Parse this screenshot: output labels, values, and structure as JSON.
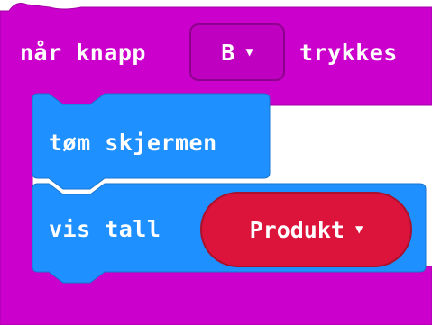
{
  "event_block": {
    "prefix": "når knapp",
    "button_value": "B",
    "suffix": "trykkes",
    "color": "#cc00cc"
  },
  "clear_block": {
    "label": "tøm skjermen",
    "color": "#1e90ff"
  },
  "show_number_block": {
    "label": "vis tall",
    "variable": "Produkt",
    "variable_color": "#dc143c"
  },
  "icons": {
    "dropdown": "chevron-down-icon"
  }
}
